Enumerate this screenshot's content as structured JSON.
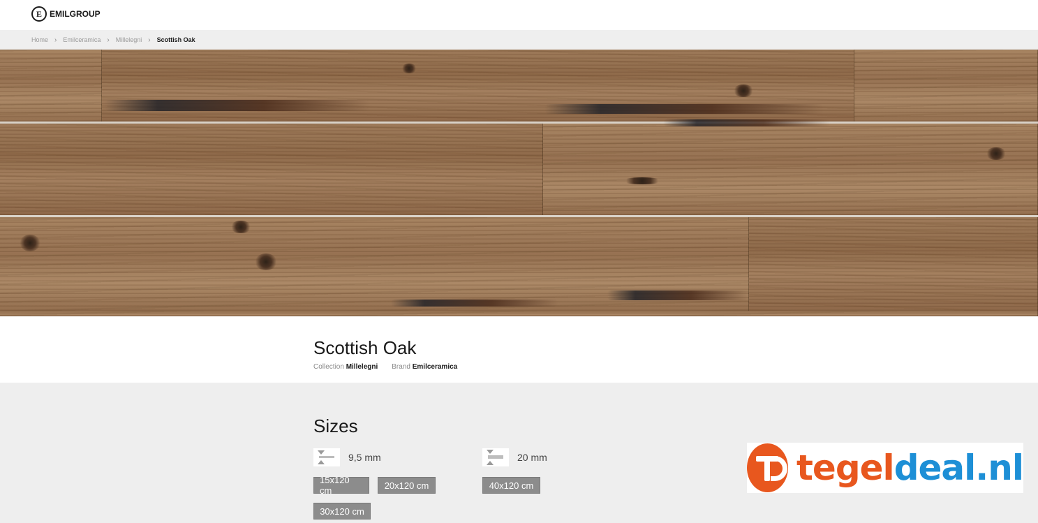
{
  "header": {
    "logo_mark": "E",
    "logo_text": "EMILGROUP"
  },
  "breadcrumb": {
    "items": [
      "Home",
      "Emilceramica",
      "Millelegni"
    ],
    "current": "Scottish Oak"
  },
  "product": {
    "title": "Scottish Oak",
    "collection_label": "Collection",
    "collection_value": "Millelegni",
    "brand_label": "Brand",
    "brand_value": "Emilceramica"
  },
  "sizes": {
    "title": "Sizes",
    "groups": [
      {
        "thickness": "9,5 mm",
        "formats": [
          "15x120 cm",
          "20x120 cm",
          "30x120 cm"
        ]
      },
      {
        "thickness": "20 mm",
        "formats": [
          "40x120 cm"
        ]
      }
    ]
  },
  "watermark": {
    "part_orange": "tegel",
    "part_blue": "deal.nl"
  },
  "colors": {
    "accent_orange": "#e8571e",
    "accent_blue": "#1d8fd6",
    "size_button": "#8c8c8c",
    "section_bg": "#eeeeee"
  }
}
